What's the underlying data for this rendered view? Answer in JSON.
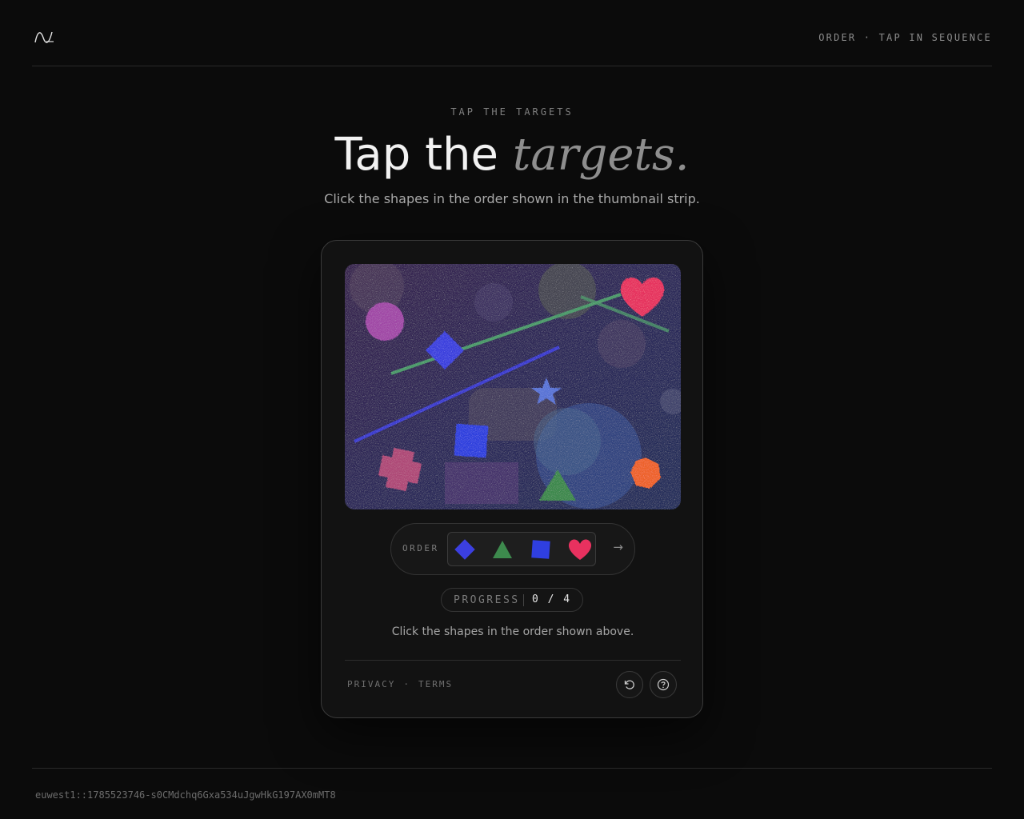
{
  "header": {
    "logo_icon": "wave-logo-icon",
    "mode_label": "ORDER · TAP IN SEQUENCE"
  },
  "hero": {
    "eyebrow": "TAP THE TARGETS",
    "title_plain": "Tap the",
    "title_italic": "targets.",
    "subtitle": "Click the shapes in the order shown in the thumbnail strip."
  },
  "challenge": {
    "canvas_shapes": [
      "purple-circle",
      "blue-diamond",
      "green-line",
      "blue-line",
      "red-heart",
      "blue-star",
      "blue-square",
      "pink-cross",
      "green-triangle",
      "orange-hexagon"
    ],
    "order_label": "ORDER",
    "order_thumbnails": [
      "blue-diamond",
      "green-triangle",
      "blue-square",
      "red-heart"
    ],
    "submit_icon": "arrow-right-icon",
    "progress_label": "PROGRESS",
    "progress_value": "0 / 4",
    "progress_done": 0,
    "progress_total": 4,
    "instruction": "Click the shapes in the order shown above.",
    "privacy_label": "PRIVACY",
    "separator": "·",
    "terms_label": "TERMS",
    "reload_icon": "reload-icon",
    "help_icon": "help-icon"
  },
  "footer": {
    "session_id": "euwest1::1785523746-s0CMdchq6Gxa534uJgwHkG197AX0mMT8"
  },
  "colors": {
    "background": "#0b0b0b",
    "heart": "#e8315f",
    "diamond": "#3b3fe0",
    "triangle": "#3d8a4d",
    "square": "#2f3fe0",
    "hexagon": "#f0632a"
  }
}
